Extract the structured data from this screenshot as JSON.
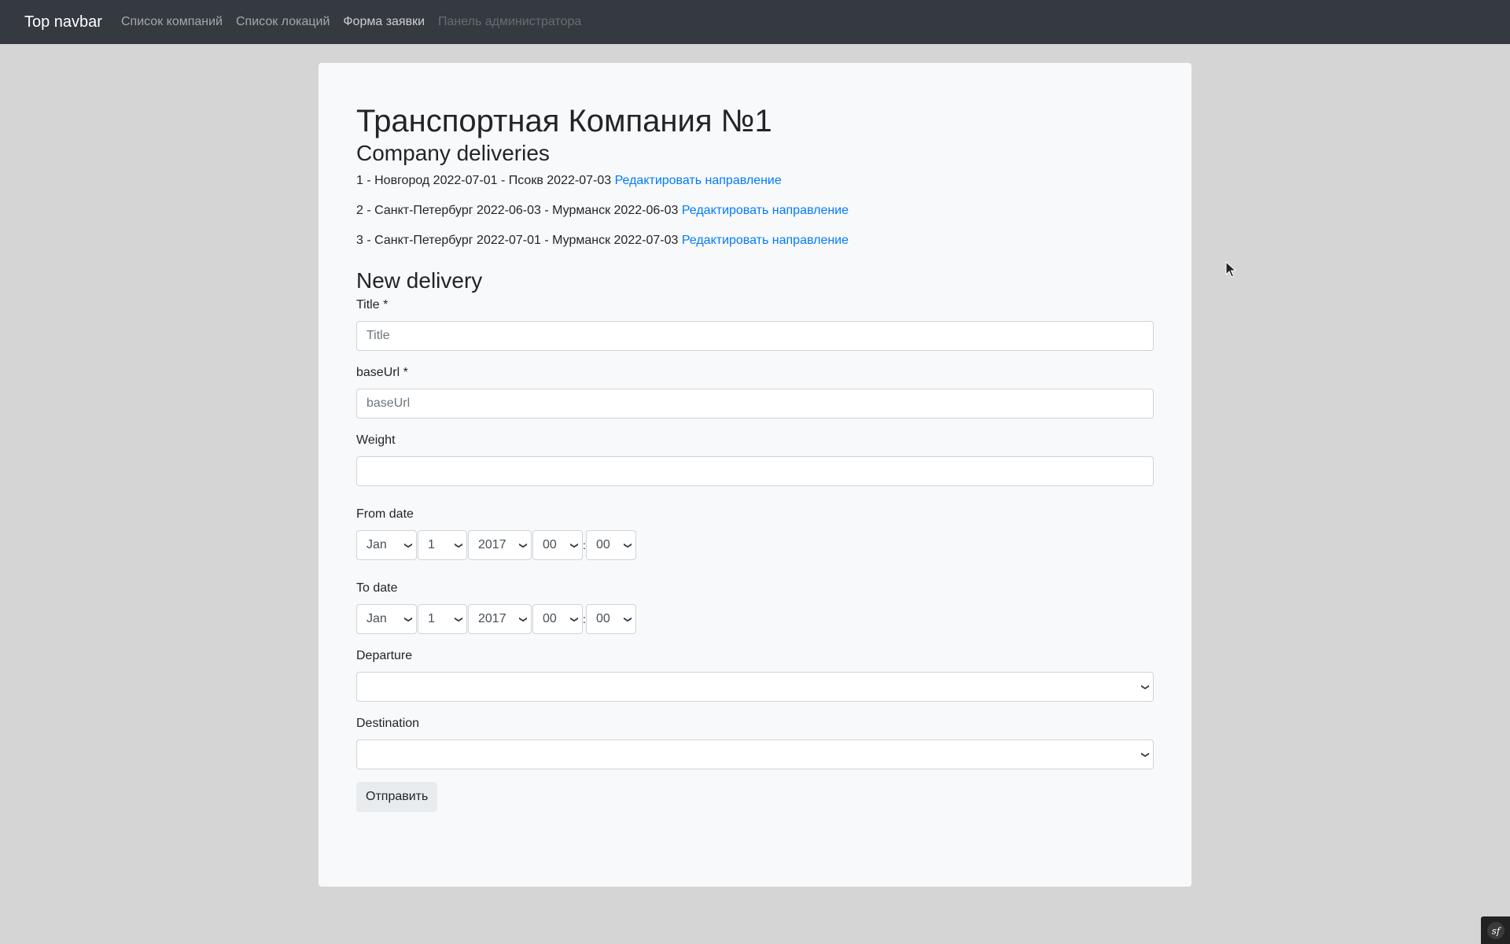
{
  "navbar": {
    "brand": "Top navbar",
    "links": [
      {
        "label": "Список компаний"
      },
      {
        "label": "Список локаций"
      },
      {
        "label": "Форма заявки"
      },
      {
        "label": "Панель администратора"
      }
    ]
  },
  "page": {
    "company_title": "Транспортная Компания №1",
    "deliveries_heading": "Company deliveries",
    "deliveries": [
      {
        "text": "1 - Новгород 2022-07-01 - Псокв 2022-07-03",
        "link": "Редактировать направление"
      },
      {
        "text": "2 - Санкт-Петербург 2022-06-03 - Мурманск 2022-06-03",
        "link": "Редактировать направление"
      },
      {
        "text": "3 - Санкт-Петербург 2022-07-01 - Мурманск 2022-07-03",
        "link": "Редактировать направление"
      }
    ]
  },
  "form": {
    "heading": "New delivery",
    "title": {
      "label": "Title *",
      "placeholder": "Title",
      "value": ""
    },
    "baseurl": {
      "label": "baseUrl *",
      "placeholder": "baseUrl",
      "value": ""
    },
    "weight": {
      "label": "Weight",
      "value": ""
    },
    "from_date": {
      "label": "From date",
      "month": "Jan",
      "day": "1",
      "year": "2017",
      "hour": "00",
      "minute": "00",
      "separator": ":"
    },
    "to_date": {
      "label": "To date",
      "month": "Jan",
      "day": "1",
      "year": "2017",
      "hour": "00",
      "minute": "00",
      "separator": ":"
    },
    "departure": {
      "label": "Departure",
      "value": ""
    },
    "destination": {
      "label": "Destination",
      "value": ""
    },
    "submit_label": "Отправить"
  },
  "icons": {
    "select_arrow": "chevron-down-icon",
    "cursor": "mouse-pointer-icon",
    "toolbar": "symfony-logo-icon"
  },
  "colors": {
    "navbar_bg": "#343a40",
    "link": "#007bff",
    "page_bg": "#d5d5d5",
    "card_bg": "#f8f9fa"
  }
}
